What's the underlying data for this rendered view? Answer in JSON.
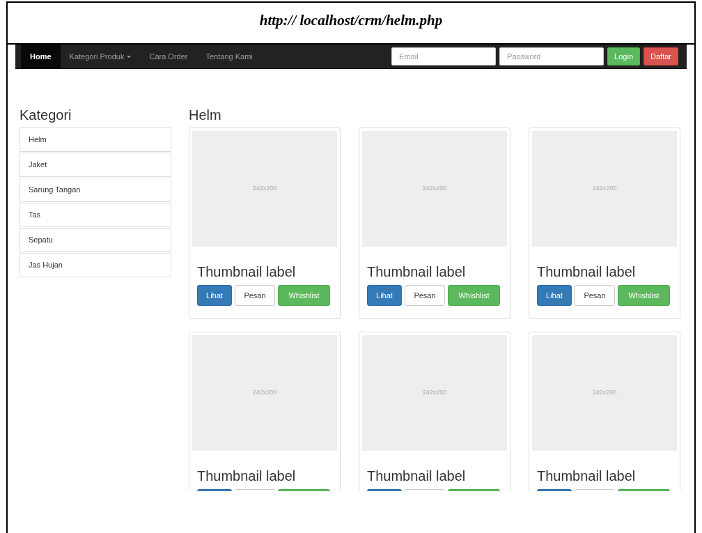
{
  "caption": "http:// localhost/crm/helm.php",
  "navbar": {
    "items": [
      {
        "label": "Home",
        "selected": true,
        "dropdown": false
      },
      {
        "label": "Kategori Produk",
        "selected": false,
        "dropdown": true
      },
      {
        "label": "Cara Order",
        "selected": false,
        "dropdown": false
      },
      {
        "label": "Tentang Kami",
        "selected": false,
        "dropdown": false
      }
    ],
    "email": {
      "placeholder": "Email"
    },
    "password": {
      "placeholder": "Password"
    },
    "buttons": [
      {
        "label": "Login",
        "kind": "success"
      },
      {
        "label": "Daftar",
        "kind": "danger"
      }
    ]
  },
  "sidebar": {
    "title": "Kategori",
    "items": [
      "Helm",
      "Jaket",
      "Sarung Tangan",
      "Tas",
      "Sepatu",
      "Jas Hujan"
    ]
  },
  "main": {
    "title": "Helm",
    "cards": [
      {
        "image": "242x200",
        "label": "Thumbnail label",
        "buttons": [
          {
            "label": "Lihat",
            "kind": "primary"
          },
          {
            "label": "Pesan",
            "kind": "default"
          },
          {
            "label": "Whishlist",
            "kind": "success"
          }
        ]
      },
      {
        "image": "242x200",
        "label": "Thumbnail label",
        "buttons": [
          {
            "label": "Lihat",
            "kind": "primary"
          },
          {
            "label": "Pesan",
            "kind": "default"
          },
          {
            "label": "Whishlist",
            "kind": "success"
          }
        ]
      },
      {
        "image": "242x200",
        "label": "Thumbnail label",
        "buttons": [
          {
            "label": "Lihat",
            "kind": "primary"
          },
          {
            "label": "Pesan",
            "kind": "default"
          },
          {
            "label": "Whishlist",
            "kind": "success"
          }
        ]
      },
      {
        "image": "242x200",
        "label": "Thumbnail label",
        "buttons": [
          {
            "kind": "primary"
          },
          {
            "kind": "default"
          },
          {
            "kind": "success"
          }
        ]
      },
      {
        "image": "242x200",
        "label": "Thumbnail label",
        "buttons": [
          {
            "kind": "primary"
          },
          {
            "kind": "default"
          },
          {
            "kind": "success"
          }
        ]
      },
      {
        "image": "242x200",
        "label": "Thumbnail label",
        "buttons": [
          {
            "kind": "primary"
          },
          {
            "kind": "default"
          },
          {
            "kind": "success"
          }
        ]
      }
    ]
  }
}
